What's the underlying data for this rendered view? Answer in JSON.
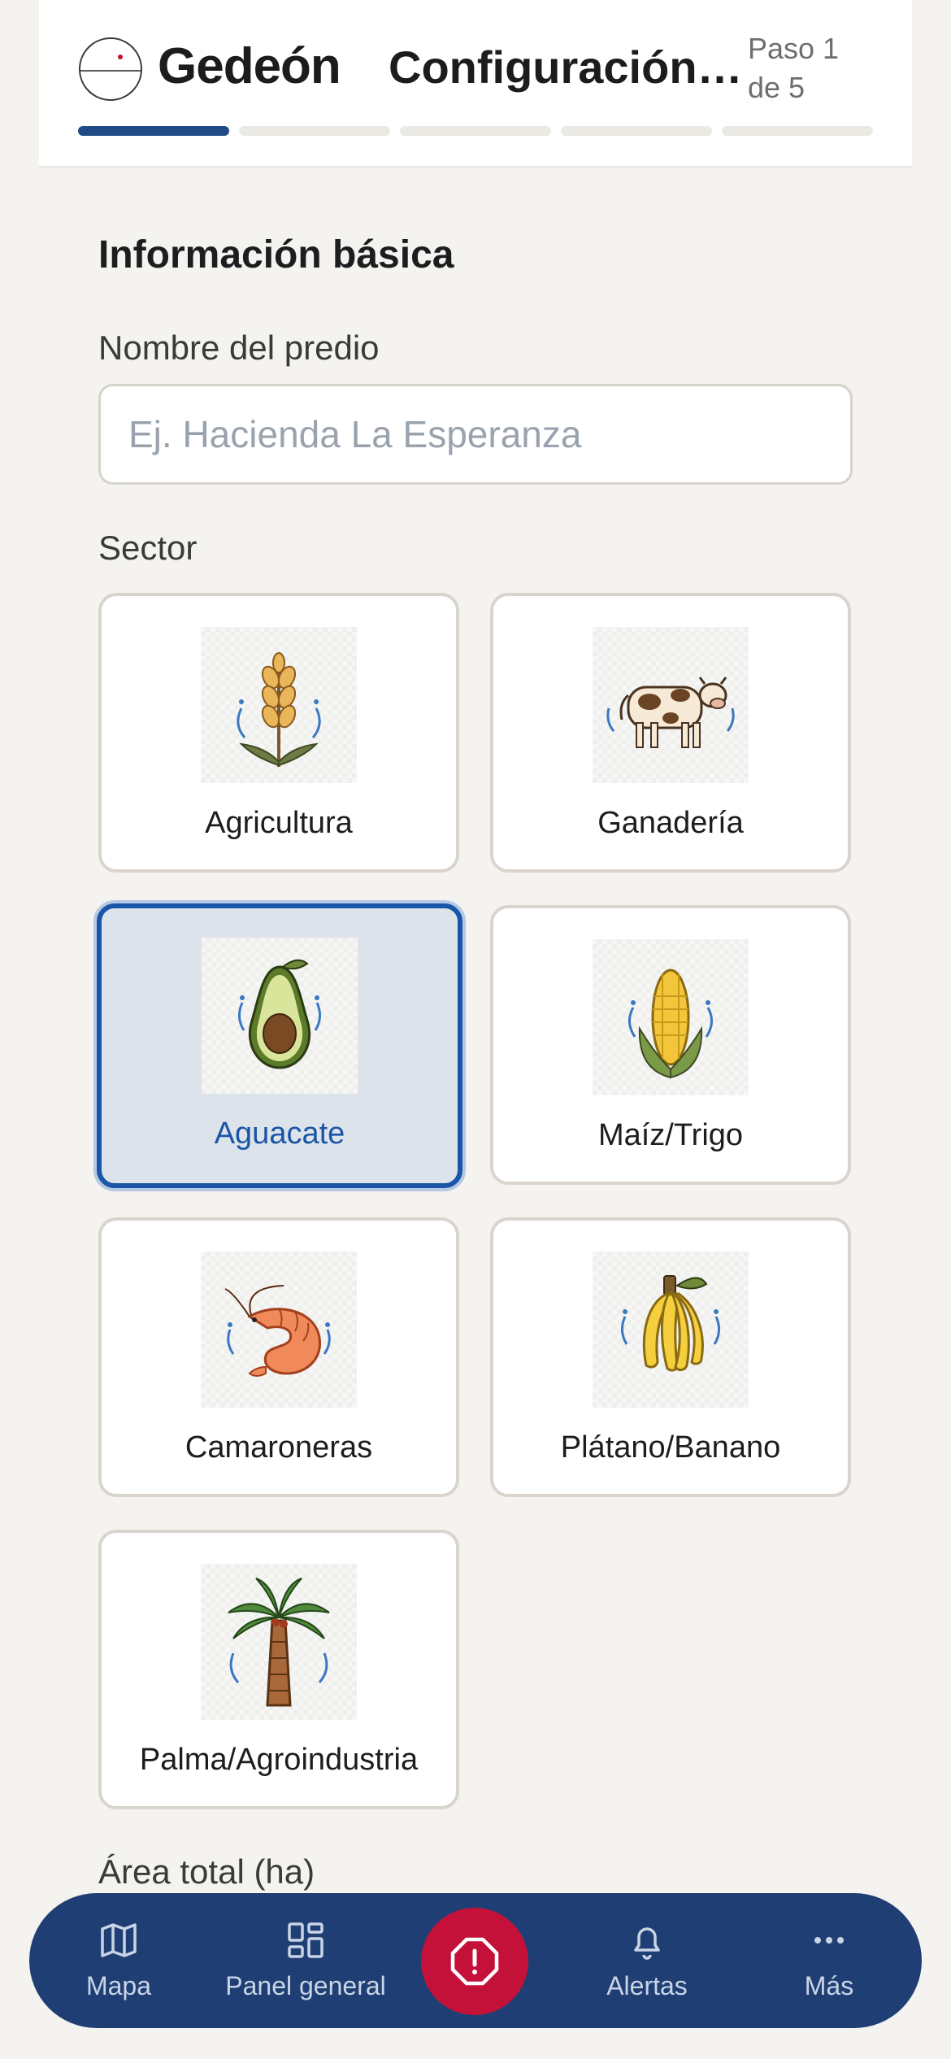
{
  "header": {
    "brand": "Gedeón",
    "step_title": "Configuración…",
    "step_count": "Paso 1 de 5",
    "progress": {
      "current_step": 1,
      "total_steps": 5
    }
  },
  "form": {
    "section_title": "Información básica",
    "name_label": "Nombre del predio",
    "name_placeholder": "Ej. Hacienda La Esperanza",
    "name_value": "",
    "sector_label": "Sector",
    "area_label": "Área total (ha)"
  },
  "sectors": [
    {
      "label": "Agricultura",
      "icon": "wheat-icon",
      "selected": false
    },
    {
      "label": "Ganadería",
      "icon": "cow-icon",
      "selected": false
    },
    {
      "label": "Aguacate",
      "icon": "avocado-icon",
      "selected": true
    },
    {
      "label": "Maíz/Trigo",
      "icon": "corn-icon",
      "selected": false
    },
    {
      "label": "Camaroneras",
      "icon": "shrimp-icon",
      "selected": false
    },
    {
      "label": "Plátano/Banano",
      "icon": "banana-icon",
      "selected": false
    },
    {
      "label": "Palma/Agroindustria",
      "icon": "palm-tree-icon",
      "selected": false
    }
  ],
  "nav": {
    "map": "Mapa",
    "dashboard": "Panel general",
    "emergency_icon": "alert-icon",
    "alerts": "Alertas",
    "more": "Más"
  },
  "colors": {
    "primary": "#1f4a86",
    "selected_border": "#1a55a8",
    "selected_bg": "#dde3ea",
    "nav_bg": "#1f3f74",
    "emergency": "#c4113a",
    "page_bg": "#f4f3ef"
  }
}
